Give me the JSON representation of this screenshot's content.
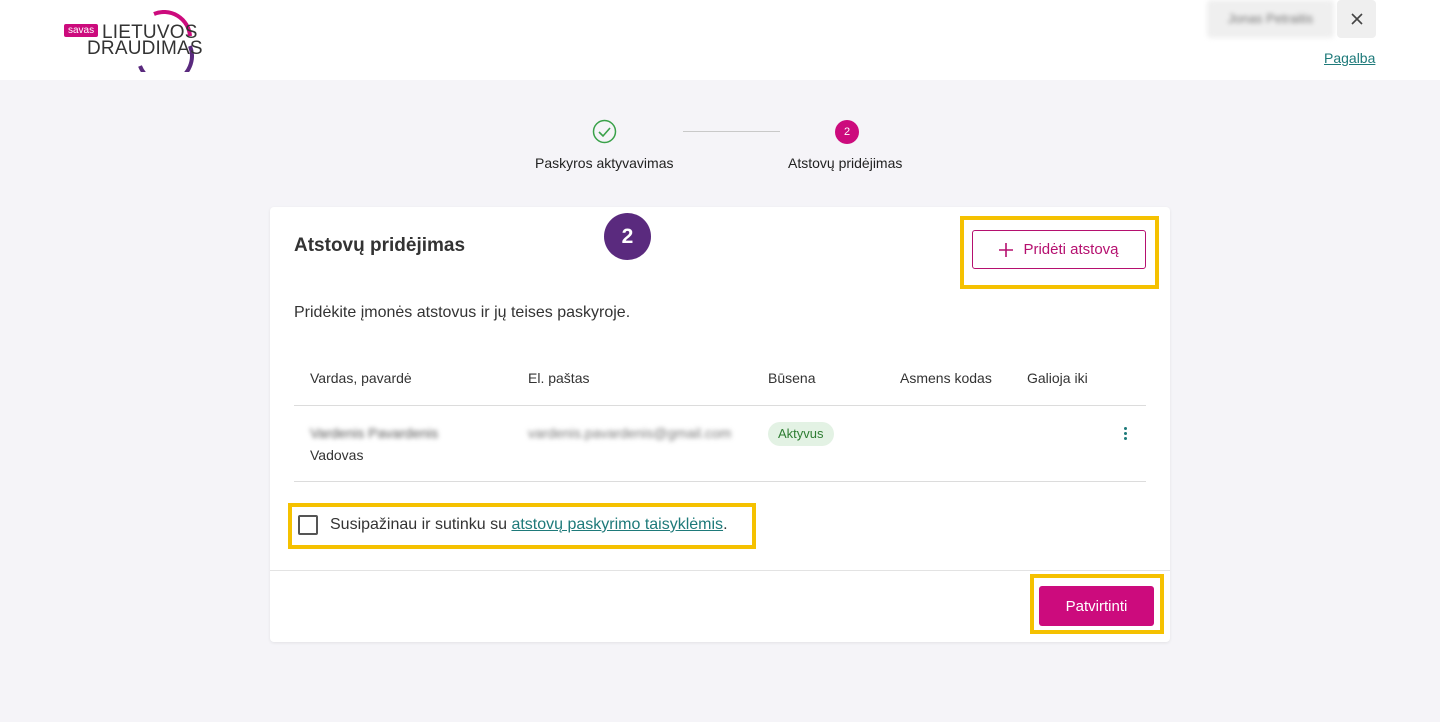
{
  "brand": {
    "tag": "savas",
    "line1": "LIETUVOS",
    "line2": "DRAUDIMAS"
  },
  "header": {
    "user_name": "Jonas Petraitis",
    "help_link": "Pagalba"
  },
  "stepper": {
    "steps": [
      {
        "label": "Paskyros aktyvavimas",
        "status": "done"
      },
      {
        "label": "Atstovų pridėjimas",
        "number": "2",
        "status": "active"
      }
    ]
  },
  "card": {
    "title": "Atstovų pridėjimas",
    "annotation_number": "2",
    "add_button_label": "Pridėti atstovą",
    "intro": "Pridėkite įmonės atstovus ir jų teises paskyroje.",
    "columns": [
      "Vardas, pavardė",
      "El. paštas",
      "Būsena",
      "Asmens kodas",
      "Galioja iki"
    ],
    "rows": [
      {
        "name": "Vardenis Pavardenis",
        "role": "Vadovas",
        "email": "vardenis.pavardenis@gmail.com",
        "status": "Aktyvus",
        "personal_code": "",
        "valid_until": ""
      }
    ],
    "agreement_prefix": "Susipažinau ir sutinku su",
    "agreement_link": "atstovų paskyrimo taisyklėmis",
    "agreement_suffix": ".",
    "confirm_button_label": "Patvirtinti"
  },
  "colors": {
    "brand": "#cc0b7d",
    "link": "#1e7a7a",
    "highlight": "#f5c100",
    "annotation": "#5a2a7e"
  }
}
